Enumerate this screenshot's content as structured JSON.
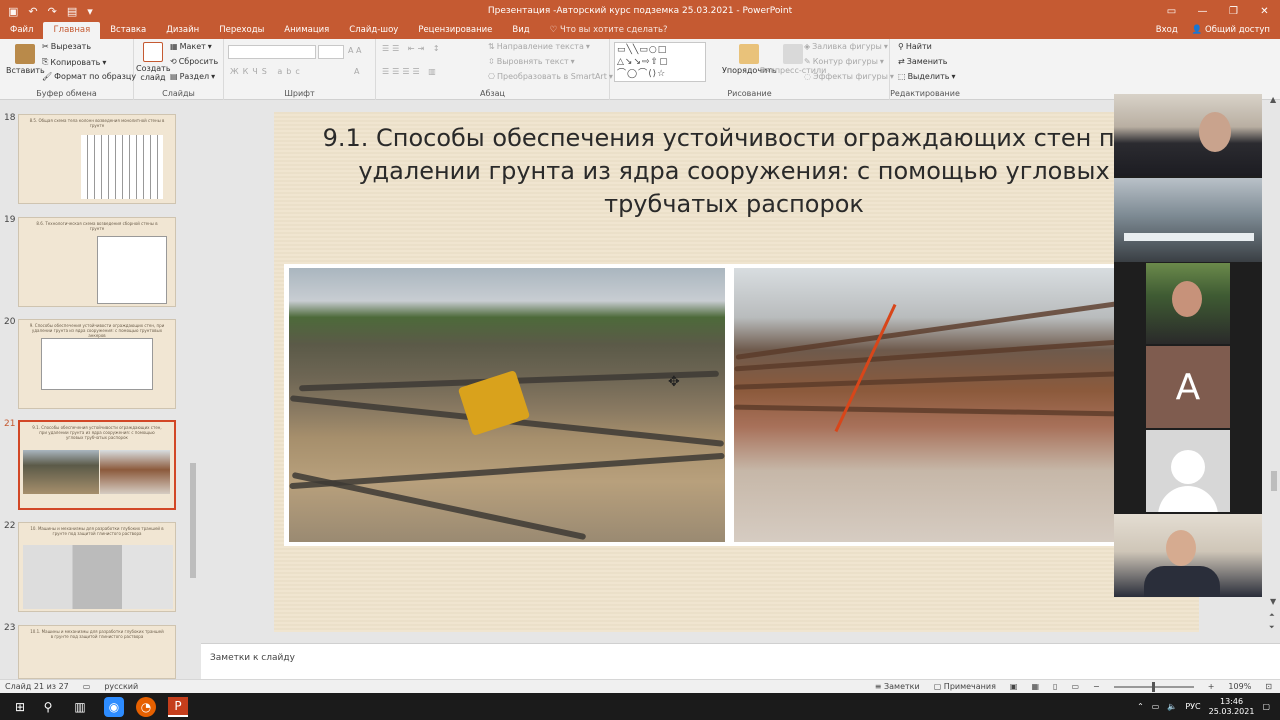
{
  "window": {
    "title": "Презентация -Авторский курс подземка 25.03.2021 - PowerPoint"
  },
  "tabs": [
    "Файл",
    "Главная",
    "Вставка",
    "Дизайн",
    "Переходы",
    "Анимация",
    "Слайд-шоу",
    "Рецензирование",
    "Вид"
  ],
  "tell_me": "Что вы хотите сделать?",
  "account": {
    "signin": "Вход",
    "share": "Общий доступ"
  },
  "ribbon": {
    "clipboard": {
      "paste": "Вставить",
      "cut": "Вырезать",
      "copy": "Копировать",
      "format_painter": "Формат по образцу",
      "name": "Буфер обмена"
    },
    "slides": {
      "new_slide": "Создать слайд",
      "layout": "Макет",
      "reset": "Сбросить",
      "section": "Раздел",
      "name": "Слайды"
    },
    "font": {
      "name": "Шрифт"
    },
    "paragraph": {
      "text_direction": "Направление текста",
      "align_text": "Выровнять текст",
      "smartart": "Преобразовать в SmartArt",
      "name": "Абзац"
    },
    "drawing": {
      "arrange": "Упорядочить",
      "quick_styles": "Экспресс-стили",
      "fill": "Заливка фигуры",
      "outline": "Контур фигуры",
      "effects": "Эффекты фигуры",
      "name": "Рисование"
    },
    "editing": {
      "find": "Найти",
      "replace": "Заменить",
      "select": "Выделить",
      "name": "Редактирование"
    }
  },
  "thumbnails": [
    {
      "num": "18",
      "title": "8.5. Общая схема тела колонн возведения монолитной стены в грунте"
    },
    {
      "num": "19",
      "title": "8.6. Технологическая схема возведения сборной стены в грунте"
    },
    {
      "num": "20",
      "title": "9. Способы обеспечения устойчивости ограждающих стен, при удалении грунта из ядра сооружения: с помощью грунтовых анкеров"
    },
    {
      "num": "21",
      "title": "9.1. Способы обеспечения устойчивости ограждающих стен, при удалении грунта из ядра сооружения: с помощью угловых трубчатых распорок"
    },
    {
      "num": "22",
      "title": "10. Машины и механизмы для разработки глубоких траншей в грунте под защитой глинистого раствора"
    },
    {
      "num": "23",
      "title": "10.1. Машины и механизмы для разработки глубоких траншей в грунте под защитой глинистого раствора"
    }
  ],
  "slide": {
    "title": "9.1. Способы обеспечения устойчивости ограждающих стен при удалении грунта из ядра сооружения: с помощью угловых трубчатых распорок"
  },
  "video": {
    "avatar_letter": "A"
  },
  "notes": {
    "placeholder": "Заметки к слайду"
  },
  "status": {
    "slide_counter": "Слайд 21 из 27",
    "language": "русский",
    "notes": "Заметки",
    "comments": "Примечания",
    "zoom": "109%"
  },
  "taskbar": {
    "lang": "РУС",
    "time": "13:46",
    "date": "25.03.2021"
  }
}
